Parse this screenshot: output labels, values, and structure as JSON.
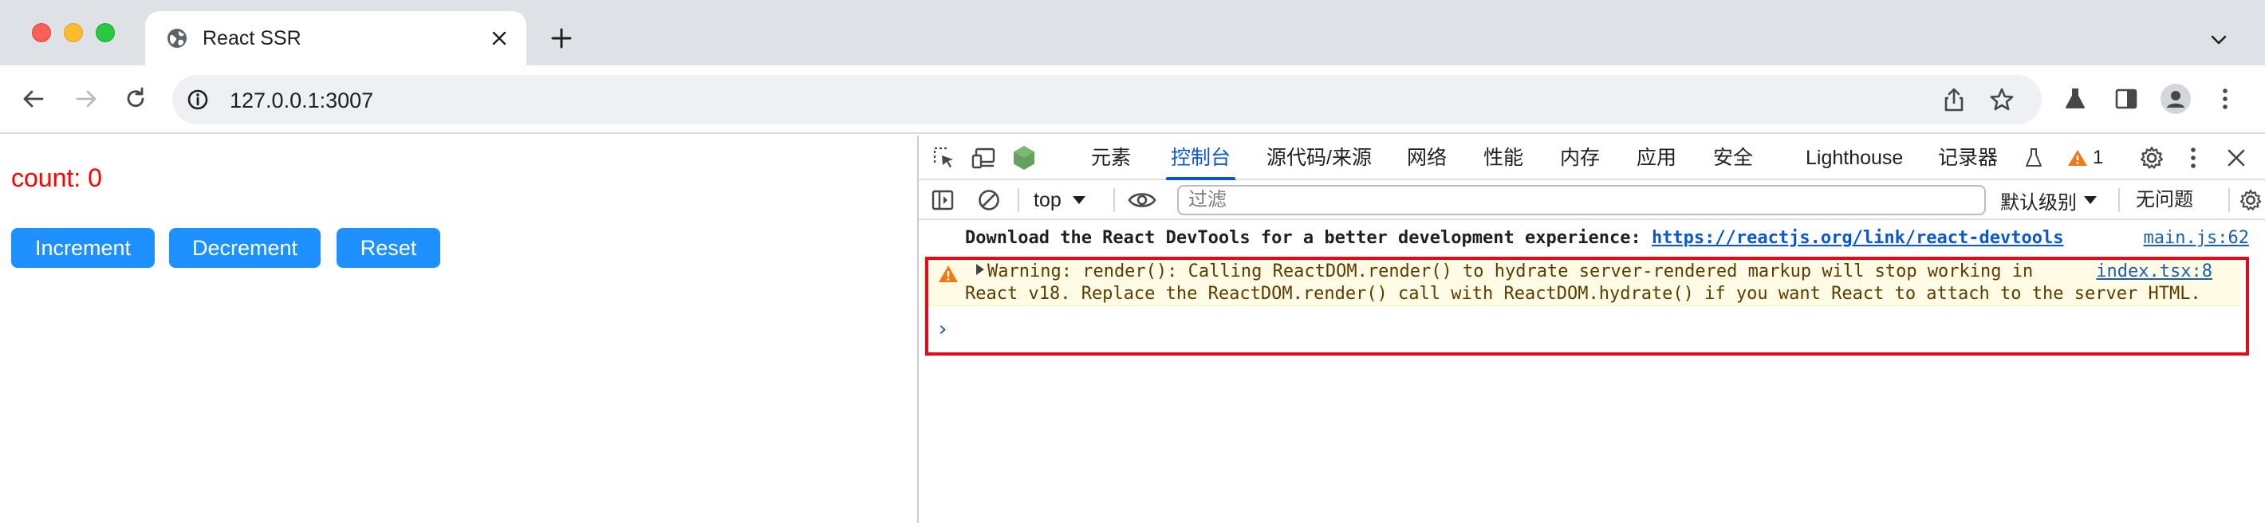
{
  "browser": {
    "tab_title": "React SSR",
    "url": "127.0.0.1:3007"
  },
  "page": {
    "count_label": "count: 0",
    "buttons": {
      "increment": "Increment",
      "decrement": "Decrement",
      "reset": "Reset"
    },
    "count_color": "#ff0000",
    "button_color": "#1e90ff"
  },
  "devtools": {
    "tabs": [
      "元素",
      "控制台",
      "源代码/来源",
      "网络",
      "性能",
      "内存",
      "应用",
      "安全",
      "Lighthouse",
      "记录器"
    ],
    "active_tab": "控制台",
    "issues_count": "1",
    "context": "top",
    "filter_placeholder": "过滤",
    "levels": "默认级别",
    "no_issues": "无问题",
    "messages": {
      "info": {
        "text": "Download the React DevTools for a better development experience: ",
        "link": "https://reactjs.org/link/react-devtools",
        "source": "main.js:62"
      },
      "warning": {
        "line1": "Warning: render(): Calling ReactDOM.render() to hydrate server-rendered markup will stop working in",
        "line2": "React v18. Replace the ReactDOM.render() call with ReactDOM.hydrate() if you want React to attach to the server HTML.",
        "source": "index.tsx:8"
      }
    },
    "prompt_symbol": "›",
    "highlight_color": "#e5091a"
  }
}
